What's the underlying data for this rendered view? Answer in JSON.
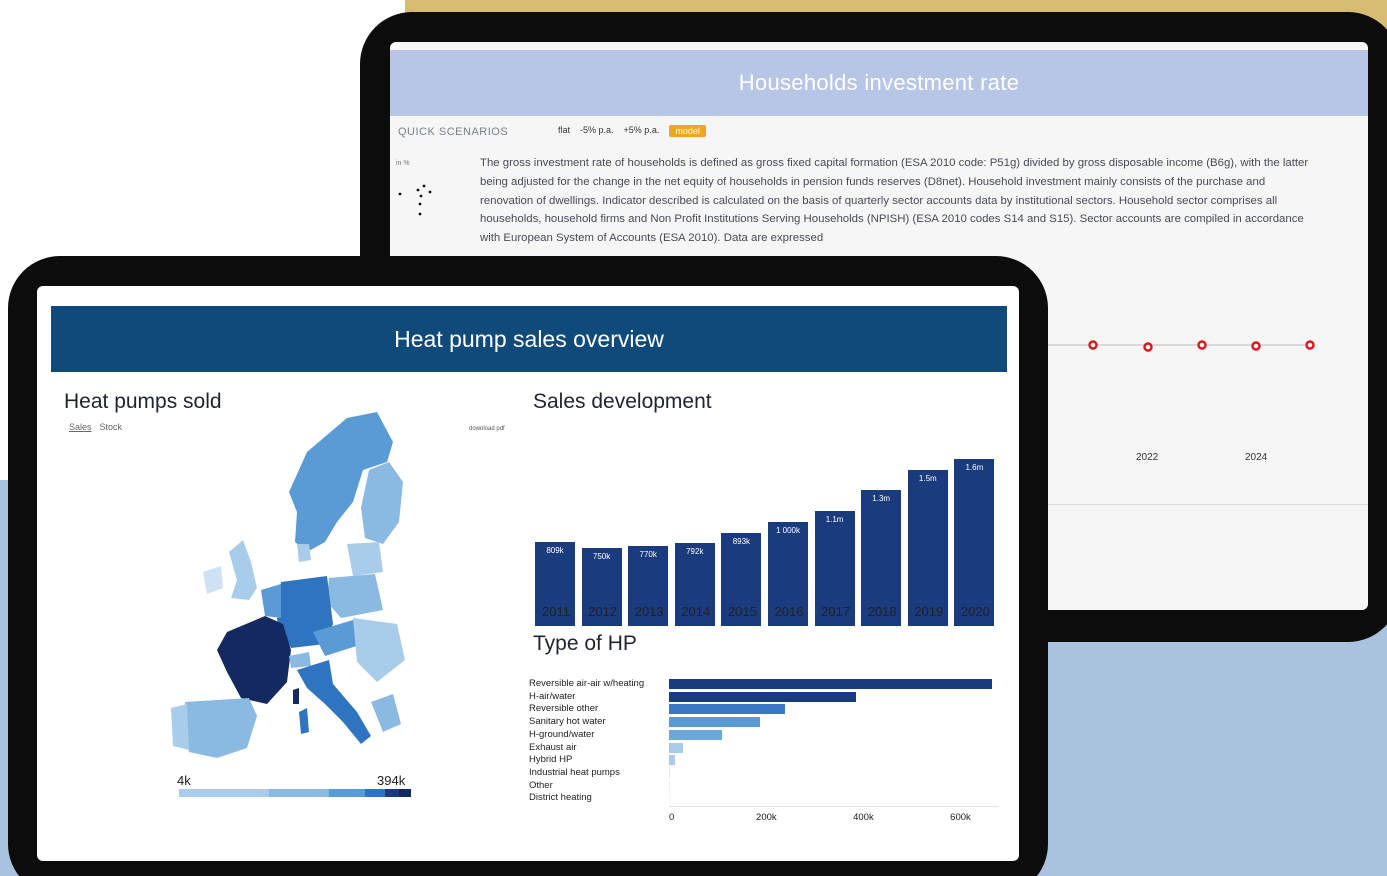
{
  "back": {
    "title": "Households investment rate",
    "quick_scenarios_label": "QUICK SCENARIOS",
    "scenarios": [
      "flat",
      "-5% p.a.",
      "+5% p.a.",
      "model"
    ],
    "active_scenario": "model",
    "unit_label": "in %",
    "description": "The gross investment rate of households is defined as gross fixed capital formation (ESA 2010 code: P51g) divided by gross disposable income (B6g), with the latter being adjusted for the change in the net equity of households in pension funds reserves (D8net). Household investment mainly consists of the purchase and renovation of dwellings. Indicator described is calculated on the basis of quarterly sector accounts data by institutional sectors. Household sector comprises all households, household firms and Non Profit Institutions Serving Households (NPISH) (ESA 2010 codes S14 and S15). Sector accounts are compiled in accordance with European System of Accounts (ESA 2010). Data are expressed",
    "axis_years": [
      "2022",
      "2024"
    ],
    "line_color": "#e3101a"
  },
  "front": {
    "header_title": "Heat pump sales overview",
    "map": {
      "title": "Heat pumps sold",
      "tabs": [
        "Sales",
        "Stock"
      ],
      "active_tab": "Sales",
      "download_label": "download pdf",
      "legend_min": "4k",
      "legend_max": "394k",
      "scale_colors": [
        "#a8cce9",
        "#8ab9e2",
        "#5a9bd6",
        "#2f74c0",
        "#1a3b7e",
        "#13295f"
      ]
    }
  },
  "chart_data": [
    {
      "type": "bar",
      "title": "Sales development",
      "categories": [
        "2011",
        "2012",
        "2013",
        "2014",
        "2015",
        "2016",
        "2017",
        "2018",
        "2019",
        "2020"
      ],
      "values": [
        809000,
        750000,
        770000,
        792000,
        893000,
        1000000,
        1100000,
        1300000,
        1500000,
        1600000
      ],
      "data_labels": [
        "809k",
        "750k",
        "770k",
        "792k",
        "893k",
        "1 000k",
        "1.1m",
        "1.3m",
        "1.5m",
        "1.6m"
      ],
      "color": "#1a3b7e"
    },
    {
      "type": "bar",
      "orientation": "horizontal",
      "title": "Type of HP",
      "categories": [
        "Reversible air-air w/heating",
        "H-air/water",
        "Reversible other",
        "Sanitary hot water",
        "H-ground/water",
        "Exhaust air",
        "Hybrid HP",
        "Industrial heat pumps",
        "Other",
        "District heating"
      ],
      "values": [
        665000,
        385000,
        240000,
        188000,
        110000,
        28000,
        12000,
        2000,
        1000,
        500
      ],
      "xlim": [
        0,
        680000
      ],
      "x_ticks": [
        "0",
        "200k",
        "400k",
        "600k"
      ],
      "color": "#1a3b7e"
    }
  ]
}
